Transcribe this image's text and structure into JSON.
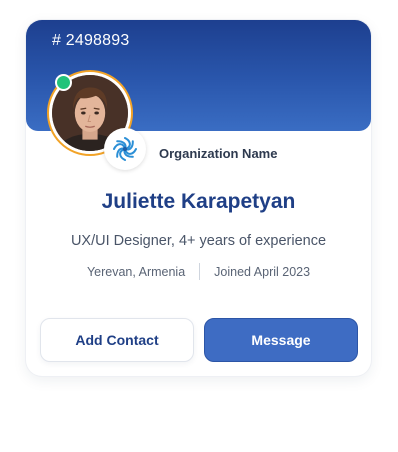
{
  "profile": {
    "id_label": "# 2498893",
    "name": "Juliette Karapetyan",
    "headline": "UX/UI Designer, 4+ years of experience",
    "location": "Yerevan, Armenia",
    "joined": "Joined April 2023",
    "online_status": "online",
    "avatar_ring_color": "#f2a327",
    "online_color": "#22c37a"
  },
  "organization": {
    "name": "Organization Name",
    "logo_icon": "globe-swirl-icon",
    "logo_color": "#2b8fd6"
  },
  "actions": {
    "add_contact_label": "Add Contact",
    "message_label": "Message"
  },
  "colors": {
    "banner_top": "#1d3f8f",
    "banner_bottom": "#3a6dc3",
    "accent": "#3e6cc3",
    "name_color": "#1f3f86"
  }
}
